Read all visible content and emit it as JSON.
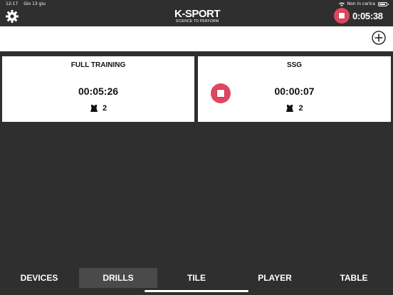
{
  "status_bar": {
    "time": "12:17",
    "date": "Gio 13 giu",
    "battery_text": "Non in carica"
  },
  "header": {
    "logo_main": "K-SPORT",
    "logo_sub": "SCIENCE TO PERFORM",
    "session_timer": "0:05:38",
    "stop_color": "#e0475d"
  },
  "drills": [
    {
      "title": "FULL TRAINING",
      "time": "00:05:26",
      "players": "2",
      "running": false
    },
    {
      "title": "SSG",
      "time": "00:00:07",
      "players": "2",
      "running": true
    }
  ],
  "tabs": [
    {
      "label": "DEVICES"
    },
    {
      "label": "DRILLS"
    },
    {
      "label": "TILE"
    },
    {
      "label": "PLAYER"
    },
    {
      "label": "TABLE"
    }
  ],
  "active_tab": "DRILLS",
  "icons": {
    "settings": "gear-icon",
    "add": "plus-circle-icon",
    "players": "vest-icon",
    "stop": "stop-icon"
  }
}
